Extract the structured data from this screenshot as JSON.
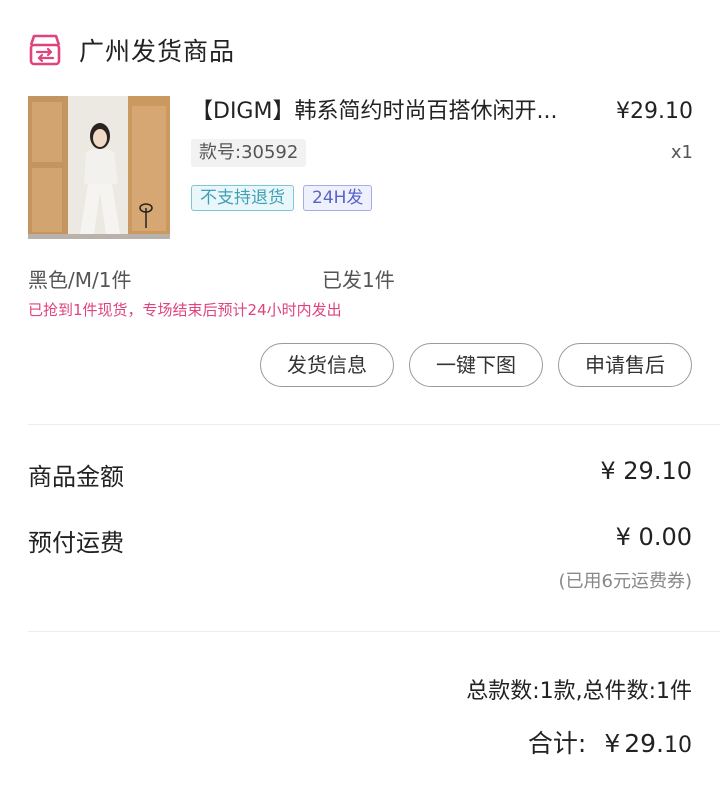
{
  "header": {
    "title": "广州发货商品",
    "icon": "shop-shipping-icon",
    "accent": "#e0437d"
  },
  "product": {
    "image": "product-photo",
    "name": "【DIGM】韩系简约时尚百搭休闲开...",
    "price": "¥29.10",
    "style_no": "款号:30592",
    "qty": "x1",
    "tags": [
      "不支持退货",
      "24H发"
    ],
    "spec": "黑色/M/1件",
    "shipped": "已发1件",
    "notice": "已抢到1件现货，专场结束后预计24小时内发出"
  },
  "actions": [
    "发货信息",
    "一键下图",
    "申请售后"
  ],
  "summary": {
    "goods_label": "商品金额",
    "goods_value": "¥ 29.10",
    "ship_label": "预付运费",
    "ship_value": "¥ 0.00",
    "coupon_note": "(已用6元运费券)",
    "count": "总款数:1款,总件数:1件",
    "total_label": "合计:",
    "total_currency": "¥",
    "total_int": "29.",
    "total_dec": "10"
  }
}
